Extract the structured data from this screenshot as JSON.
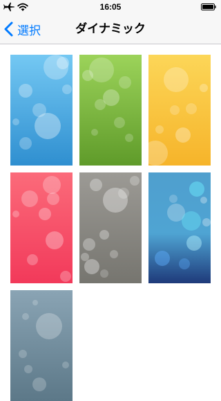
{
  "status_bar": {
    "time": "16:05",
    "airplane_icon": "airplane-icon",
    "wifi_icon": "wifi-icon",
    "battery_icon": "battery-icon"
  },
  "nav": {
    "back_label": "選択",
    "back_icon": "chevron-left-icon",
    "title": "ダイナミック",
    "accent_color": "#007aff"
  },
  "wallpapers": [
    {
      "name": "blue",
      "top": "#74c8f3",
      "bottom": "#2f8fd0"
    },
    {
      "name": "green",
      "top": "#9cd35a",
      "bottom": "#5f9b2a"
    },
    {
      "name": "yellow",
      "top": "#fcd658",
      "bottom": "#f6b42a"
    },
    {
      "name": "red",
      "top": "#fb6b7a",
      "bottom": "#f2395a"
    },
    {
      "name": "gray",
      "top": "#9c9a95",
      "bottom": "#76756f"
    },
    {
      "name": "blue-cyan",
      "top": "#4f9fce",
      "bottom": "#1e3a7a"
    },
    {
      "name": "slate",
      "top": "#8aa4b4",
      "bottom": "#5c7888"
    }
  ]
}
